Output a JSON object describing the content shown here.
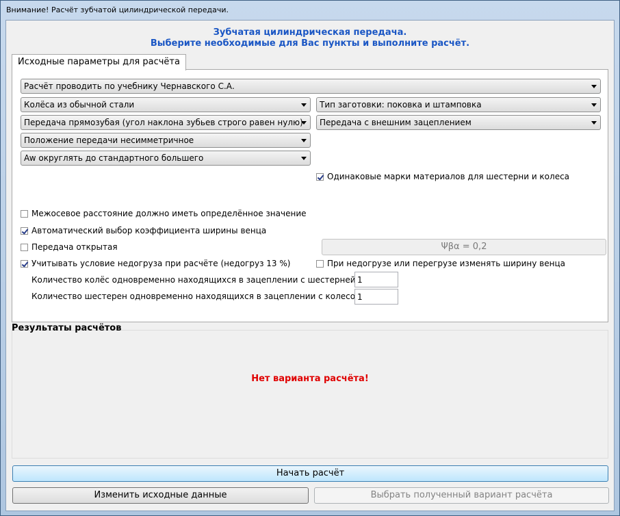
{
  "window": {
    "title": "Внимание! Расчёт зубчатой цилиндрической передачи."
  },
  "header": {
    "line1": "Зубчатая цилиндрическая передача.",
    "line2": "Выберите необходимые для Вас пункты и выполните расчёт."
  },
  "tab": {
    "label": "Исходные параметры для расчёта"
  },
  "combos": {
    "textbook": "Расчёт проводить по учебнику Чернавского С.А.",
    "material": "Колёса из обычной стали",
    "blank_type": "Тип заготовки: поковка и штамповка",
    "teeth": "Передача прямозубая (угол наклона зубьев строго равен нулю)",
    "mesh": "Передача с внешним зацеплением",
    "position": "Положение передачи несимметричное",
    "aw_round": "Aw округлять до стандартного большего"
  },
  "checkboxes": {
    "same_material": {
      "label": "Одинаковые марки материалов для шестерни и колеса",
      "checked": true
    },
    "center_distance": {
      "label": "Межосевое расстояние должно иметь определённое значение",
      "checked": false
    },
    "auto_width": {
      "label": "Автоматический выбор коэффициента ширины венца",
      "checked": true
    },
    "open_gear": {
      "label": "Передача открытая",
      "checked": false
    },
    "underload": {
      "label": "Учитывать условие недогруза при расчёте (недогруз 13 %)",
      "checked": true
    },
    "change_width": {
      "label": "При недогрузе или перегрузе изменять ширину венца",
      "checked": false
    }
  },
  "psi_field": {
    "value": "Ψβα = 0,2"
  },
  "counts": {
    "wheels_label": "Количество колёс одновременно находящихся в зацеплении с шестерней",
    "wheels_value": "1",
    "pinions_label": "Количество шестерен одновременно находящихся в зацеплении с колесом",
    "pinions_value": "1"
  },
  "results": {
    "title": "Результаты расчётов",
    "message": "Нет варианта расчёта!"
  },
  "buttons": {
    "start": "Начать расчёт",
    "change_input": "Изменить исходные данные",
    "select_variant": "Выбрать полученный вариант расчёта"
  },
  "colors": {
    "header": "#1a56c4",
    "error": "#e00000"
  }
}
